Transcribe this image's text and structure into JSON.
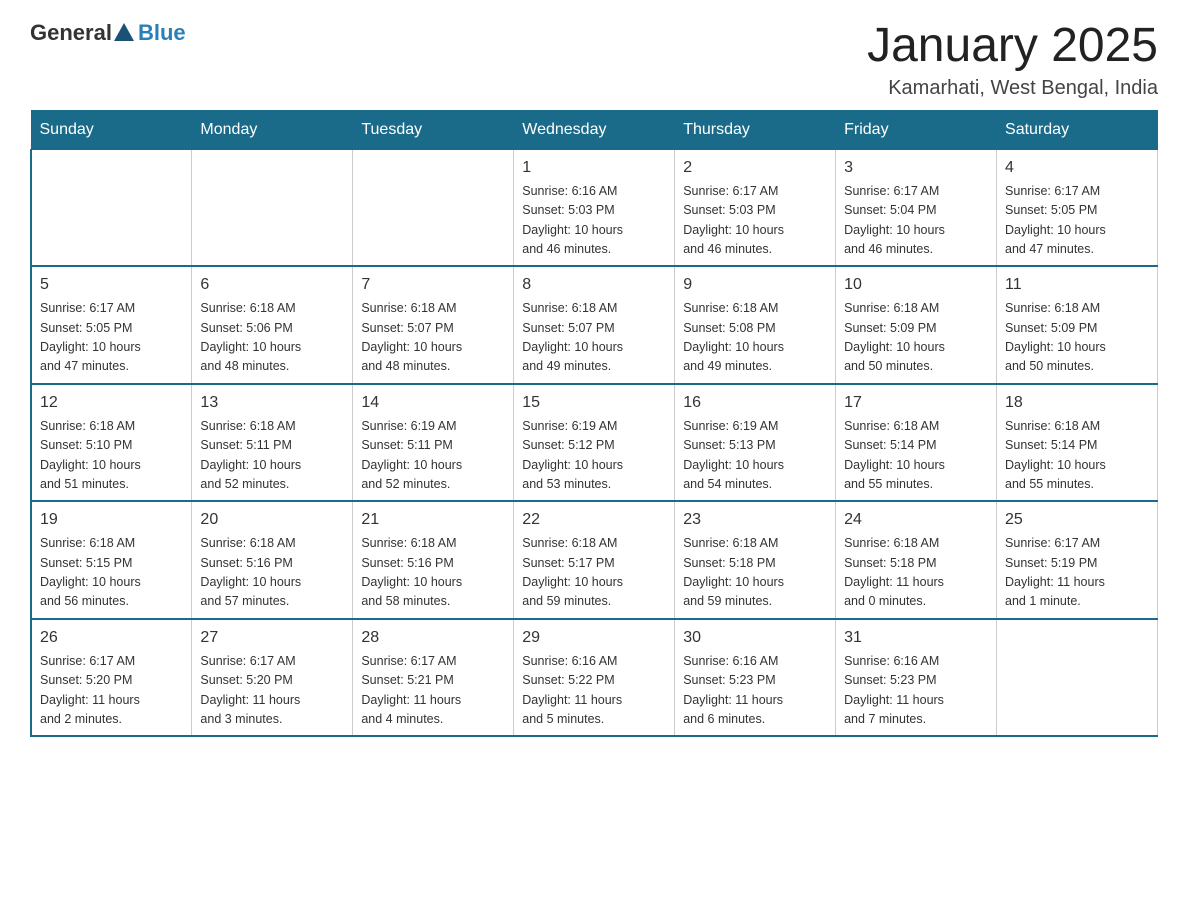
{
  "header": {
    "logo_general": "General",
    "logo_blue": "Blue",
    "title": "January 2025",
    "subtitle": "Kamarhati, West Bengal, India"
  },
  "weekdays": [
    "Sunday",
    "Monday",
    "Tuesday",
    "Wednesday",
    "Thursday",
    "Friday",
    "Saturday"
  ],
  "weeks": [
    [
      {
        "day": "",
        "info": ""
      },
      {
        "day": "",
        "info": ""
      },
      {
        "day": "",
        "info": ""
      },
      {
        "day": "1",
        "info": "Sunrise: 6:16 AM\nSunset: 5:03 PM\nDaylight: 10 hours\nand 46 minutes."
      },
      {
        "day": "2",
        "info": "Sunrise: 6:17 AM\nSunset: 5:03 PM\nDaylight: 10 hours\nand 46 minutes."
      },
      {
        "day": "3",
        "info": "Sunrise: 6:17 AM\nSunset: 5:04 PM\nDaylight: 10 hours\nand 46 minutes."
      },
      {
        "day": "4",
        "info": "Sunrise: 6:17 AM\nSunset: 5:05 PM\nDaylight: 10 hours\nand 47 minutes."
      }
    ],
    [
      {
        "day": "5",
        "info": "Sunrise: 6:17 AM\nSunset: 5:05 PM\nDaylight: 10 hours\nand 47 minutes."
      },
      {
        "day": "6",
        "info": "Sunrise: 6:18 AM\nSunset: 5:06 PM\nDaylight: 10 hours\nand 48 minutes."
      },
      {
        "day": "7",
        "info": "Sunrise: 6:18 AM\nSunset: 5:07 PM\nDaylight: 10 hours\nand 48 minutes."
      },
      {
        "day": "8",
        "info": "Sunrise: 6:18 AM\nSunset: 5:07 PM\nDaylight: 10 hours\nand 49 minutes."
      },
      {
        "day": "9",
        "info": "Sunrise: 6:18 AM\nSunset: 5:08 PM\nDaylight: 10 hours\nand 49 minutes."
      },
      {
        "day": "10",
        "info": "Sunrise: 6:18 AM\nSunset: 5:09 PM\nDaylight: 10 hours\nand 50 minutes."
      },
      {
        "day": "11",
        "info": "Sunrise: 6:18 AM\nSunset: 5:09 PM\nDaylight: 10 hours\nand 50 minutes."
      }
    ],
    [
      {
        "day": "12",
        "info": "Sunrise: 6:18 AM\nSunset: 5:10 PM\nDaylight: 10 hours\nand 51 minutes."
      },
      {
        "day": "13",
        "info": "Sunrise: 6:18 AM\nSunset: 5:11 PM\nDaylight: 10 hours\nand 52 minutes."
      },
      {
        "day": "14",
        "info": "Sunrise: 6:19 AM\nSunset: 5:11 PM\nDaylight: 10 hours\nand 52 minutes."
      },
      {
        "day": "15",
        "info": "Sunrise: 6:19 AM\nSunset: 5:12 PM\nDaylight: 10 hours\nand 53 minutes."
      },
      {
        "day": "16",
        "info": "Sunrise: 6:19 AM\nSunset: 5:13 PM\nDaylight: 10 hours\nand 54 minutes."
      },
      {
        "day": "17",
        "info": "Sunrise: 6:18 AM\nSunset: 5:14 PM\nDaylight: 10 hours\nand 55 minutes."
      },
      {
        "day": "18",
        "info": "Sunrise: 6:18 AM\nSunset: 5:14 PM\nDaylight: 10 hours\nand 55 minutes."
      }
    ],
    [
      {
        "day": "19",
        "info": "Sunrise: 6:18 AM\nSunset: 5:15 PM\nDaylight: 10 hours\nand 56 minutes."
      },
      {
        "day": "20",
        "info": "Sunrise: 6:18 AM\nSunset: 5:16 PM\nDaylight: 10 hours\nand 57 minutes."
      },
      {
        "day": "21",
        "info": "Sunrise: 6:18 AM\nSunset: 5:16 PM\nDaylight: 10 hours\nand 58 minutes."
      },
      {
        "day": "22",
        "info": "Sunrise: 6:18 AM\nSunset: 5:17 PM\nDaylight: 10 hours\nand 59 minutes."
      },
      {
        "day": "23",
        "info": "Sunrise: 6:18 AM\nSunset: 5:18 PM\nDaylight: 10 hours\nand 59 minutes."
      },
      {
        "day": "24",
        "info": "Sunrise: 6:18 AM\nSunset: 5:18 PM\nDaylight: 11 hours\nand 0 minutes."
      },
      {
        "day": "25",
        "info": "Sunrise: 6:17 AM\nSunset: 5:19 PM\nDaylight: 11 hours\nand 1 minute."
      }
    ],
    [
      {
        "day": "26",
        "info": "Sunrise: 6:17 AM\nSunset: 5:20 PM\nDaylight: 11 hours\nand 2 minutes."
      },
      {
        "day": "27",
        "info": "Sunrise: 6:17 AM\nSunset: 5:20 PM\nDaylight: 11 hours\nand 3 minutes."
      },
      {
        "day": "28",
        "info": "Sunrise: 6:17 AM\nSunset: 5:21 PM\nDaylight: 11 hours\nand 4 minutes."
      },
      {
        "day": "29",
        "info": "Sunrise: 6:16 AM\nSunset: 5:22 PM\nDaylight: 11 hours\nand 5 minutes."
      },
      {
        "day": "30",
        "info": "Sunrise: 6:16 AM\nSunset: 5:23 PM\nDaylight: 11 hours\nand 6 minutes."
      },
      {
        "day": "31",
        "info": "Sunrise: 6:16 AM\nSunset: 5:23 PM\nDaylight: 11 hours\nand 7 minutes."
      },
      {
        "day": "",
        "info": ""
      }
    ]
  ]
}
